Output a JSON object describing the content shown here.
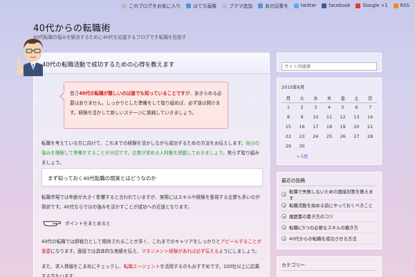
{
  "topbar": {
    "items": [
      {
        "label": "このブログをお気に入り",
        "icon": "bookmark-icon"
      },
      {
        "label": "はてな画像",
        "icon": "hatena-icon"
      },
      {
        "label": "ブクマ追加",
        "icon": "bookmark-add-icon"
      },
      {
        "label": "あの記事を",
        "icon": "share-icon"
      },
      {
        "label": "twitter",
        "icon": "twitter-icon"
      },
      {
        "label": "facebook",
        "icon": "facebook-icon"
      },
      {
        "label": "Google +1",
        "icon": "googleplus-icon"
      },
      {
        "label": "RSS",
        "icon": "rss-icon"
      }
    ]
  },
  "site": {
    "title": "40代からの転職術",
    "description": "40代転職の悩みを解決するために40代を応援するブログです転職を目指す"
  },
  "post": {
    "title": "40代の転職活動で成功するための心得を教えます",
    "speech": {
      "prefix": "皆さ",
      "highlight": "40代の転職が難しいのは誰でも知っていることです",
      "rest": "が、あきらめる必要はありません。しっかりとした準備をして取り組めば、必ず道は開けます。経験を活かして新しいステージに挑戦していきましょう。"
    },
    "para1_normal": "転職を考えている方に向けて、これまでの経験を活かしながら成功するための方法をお伝えします。",
    "para1_green": "自分の強みを理解して準備をすることが大切です。企業が求める人材像を把握しておきましょう。",
    "para1_tail": "焦らず取り組みましょう。",
    "section_heading": "まず知っておく40代転職の現実とはどうなのか",
    "para2": "転職市場では年齢が大きく影響すると言われていますが、実際にはスキルや経験を重視する企業も多いのが現状です。40代ならではの強みを活かすことが成功への近道となります。",
    "point_label": "ポイントをまとめると",
    "para3_normal": "40代の転職では即戦力として期待されることが多く、これまでのキャリアをしっかりと",
    "para3_red": "アピールすることが重要",
    "para3_tail": "になります。面接では具体的な実績を伝え、",
    "para3_red2": "マネジメント経験があれば必ず伝える",
    "para3_end": "ようにしましょう。",
    "para4_normal": "また、求人情報をこまめにチェックし、",
    "para4_red": "転職エージェント",
    "para4_tail": "を活用するのもおすすめです。100社以上に応募する方もいます。"
  },
  "sidebar": {
    "search_placeholder": "サイト内検索",
    "calendar": {
      "title": "2015年6月",
      "weekdays": [
        "月",
        "火",
        "水",
        "木",
        "金",
        "土",
        "日"
      ],
      "weeks": [
        [
          "1",
          "2",
          "3",
          "4",
          "5",
          "6",
          "7"
        ],
        [
          "8",
          "9",
          "10",
          "11",
          "12",
          "13",
          "14"
        ],
        [
          "15",
          "16",
          "17",
          "18",
          "19",
          "20",
          "21"
        ],
        [
          "22",
          "23",
          "24",
          "25",
          "26",
          "27",
          "28"
        ],
        [
          "29",
          "30",
          "",
          "",
          "",
          "",
          ""
        ]
      ],
      "prev_link": "« 5月"
    },
    "recent": {
      "heading": "最近の投稿",
      "items": [
        "転職で失敗しないための面接対策を教えます",
        "転職活動を始める前にやっておくべきこと",
        "履歴書の書き方のコツ",
        "転職に5つの必要なスキルの磨き方",
        "40代からの転職を成功させる方法"
      ]
    },
    "categories": {
      "heading": "カテゴリー"
    }
  }
}
